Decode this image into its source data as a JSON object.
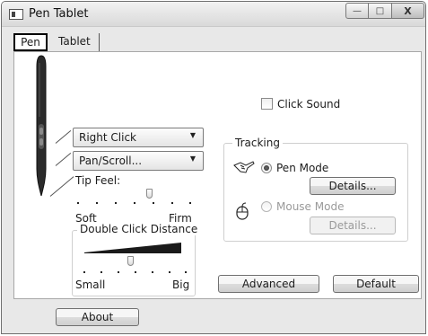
{
  "window": {
    "title": "Pen Tablet",
    "controls": {
      "minimize": "—",
      "maximize": "□",
      "close": "X"
    }
  },
  "tabs": [
    {
      "label": "Pen",
      "selected": true
    },
    {
      "label": "Tablet",
      "selected": false
    }
  ],
  "pen": {
    "button_upper": {
      "selected": "Right Click"
    },
    "button_lower": {
      "selected": "Pan/Scroll..."
    },
    "tip_feel": {
      "label": "Tip Feel:",
      "min_label": "Soft",
      "max_label": "Firm",
      "level": 0.6
    },
    "double_click": {
      "label": "Double Click Distance",
      "min_label": "Small",
      "max_label": "Big",
      "level": 0.4
    },
    "click_sound": {
      "label": "Click Sound",
      "checked": false
    },
    "tracking": {
      "title": "Tracking",
      "pen_mode": {
        "label": "Pen Mode",
        "selected": true,
        "details_label": "Details..."
      },
      "mouse_mode": {
        "label": "Mouse Mode",
        "selected": false,
        "details_label": "Details..."
      }
    },
    "advanced_label": "Advanced",
    "default_label": "Default"
  },
  "footer": {
    "about_label": "About"
  },
  "icons": {
    "app": "pen-tablet-app-icon",
    "stylus": "stylus-pen-icon",
    "pen_mode": "pen-hand-icon",
    "mouse_mode": "mouse-icon"
  }
}
